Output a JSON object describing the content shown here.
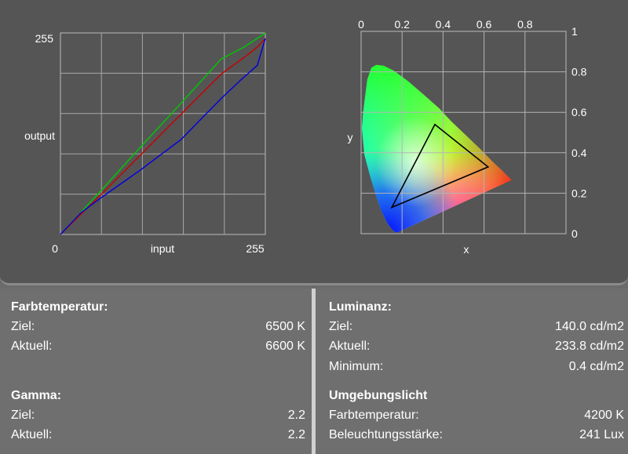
{
  "chart_data": [
    {
      "type": "line",
      "xlabel": "input",
      "ylabel": "output",
      "x_ticks": [
        "0",
        "255"
      ],
      "y_ticks": [
        "255"
      ],
      "xlim": [
        0,
        255
      ],
      "ylim": [
        0,
        255
      ],
      "grid": true,
      "series": [
        {
          "color": "#00c800",
          "x": [
            0,
            50,
            100,
            150,
            200,
            230,
            255
          ],
          "y": [
            0,
            55,
            111,
            166,
            222,
            238,
            255
          ]
        },
        {
          "color": "#c80000",
          "x": [
            0,
            50,
            100,
            150,
            200,
            230,
            245,
            255
          ],
          "y": [
            0,
            50,
            101,
            152,
            203,
            225,
            237,
            248
          ]
        },
        {
          "color": "#0000dd",
          "x": [
            0,
            25,
            50,
            75,
            100,
            125,
            150,
            175,
            200,
            225,
            245,
            255
          ],
          "y": [
            0,
            27,
            46,
            64,
            82,
            101,
            120,
            146,
            172,
            196,
            214,
            248
          ]
        }
      ]
    },
    {
      "type": "scatter",
      "xlabel": "x",
      "ylabel": "y",
      "x_ticks": [
        "0",
        "0.2",
        "0.4",
        "0.6",
        "0.8"
      ],
      "y_ticks": [
        "0",
        "0.2",
        "0.4",
        "0.6",
        "0.8",
        "1"
      ],
      "xlim": [
        0,
        1
      ],
      "ylim": [
        0,
        1
      ],
      "grid": true,
      "gamut_triangle": [
        [
          0.36,
          0.54
        ],
        [
          0.62,
          0.33
        ],
        [
          0.15,
          0.13
        ]
      ]
    }
  ],
  "farbtemperatur": {
    "title": "Farbtemperatur:",
    "ziel_label": "Ziel:",
    "ziel_value": "6500 K",
    "aktuell_label": "Aktuell:",
    "aktuell_value": "6600 K"
  },
  "gamma": {
    "title": "Gamma:",
    "ziel_label": "Ziel:",
    "ziel_value": "2.2",
    "aktuell_label": "Aktuell:",
    "aktuell_value": "2.2"
  },
  "luminanz": {
    "title": "Luminanz:",
    "ziel_label": "Ziel:",
    "ziel_value": "140.0 cd/m2",
    "aktuell_label": "Aktuell:",
    "aktuell_value": "233.8 cd/m2",
    "minimum_label": "Minimum:",
    "minimum_value": "0.4 cd/m2"
  },
  "umgebungslicht": {
    "title": "Umgebungslicht",
    "farbtemp_label": "Farbtemperatur:",
    "farbtemp_value": "4200 K",
    "beleuchtung_label": "Beleuchtungsstärke:",
    "beleuchtung_value": "241 Lux"
  }
}
